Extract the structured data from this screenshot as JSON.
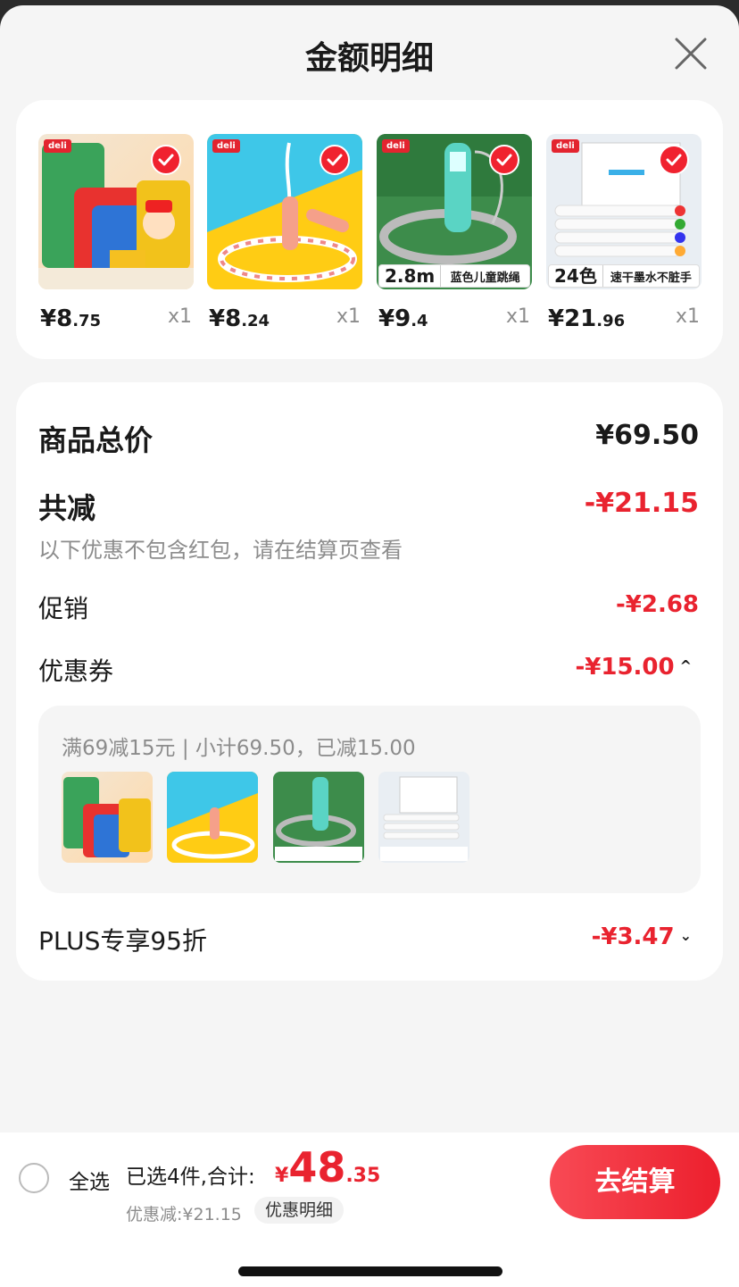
{
  "header": {
    "title": "金额明细",
    "close_icon": "close-icon"
  },
  "products": [
    {
      "int": "¥8",
      "dec": ".75",
      "qty": "x1",
      "tag_big": "",
      "tag_text": ""
    },
    {
      "int": "¥8",
      "dec": ".24",
      "qty": "x1",
      "tag_big": "",
      "tag_text": ""
    },
    {
      "int": "¥9",
      "dec": ".4",
      "qty": "x1",
      "tag_big": "2.8m",
      "tag_text": "蓝色儿童跳绳"
    },
    {
      "int": "¥21",
      "dec": ".96",
      "qty": "x1",
      "tag_big": "24色",
      "tag_text": "速干墨水不脏手"
    }
  ],
  "summary": {
    "total_label": "商品总价",
    "total_value": "¥69.50",
    "reduce_label": "共减",
    "reduce_value": "-¥21.15",
    "reduce_note": "以下优惠不包含红包，请在结算页查看",
    "promo_label": "促销",
    "promo_value": "-¥2.68",
    "coupon_label": "优惠券",
    "coupon_value": "-¥15.00",
    "coupon_detail": "满69减15元 | 小计69.50，已减15.00",
    "plus_label": "PLUS专享95折",
    "plus_value": "-¥3.47"
  },
  "bottom": {
    "select_all": "全选",
    "selected_count": "已选4件,合计:",
    "total_currency": "¥",
    "total_int": "48",
    "total_dec": ".35",
    "discount_text": "优惠减:¥21.15",
    "detail_button": "优惠明细",
    "checkout_button": "去结算"
  },
  "colors": {
    "accent_red": "#e9232f",
    "background": "#f5f5f5"
  }
}
